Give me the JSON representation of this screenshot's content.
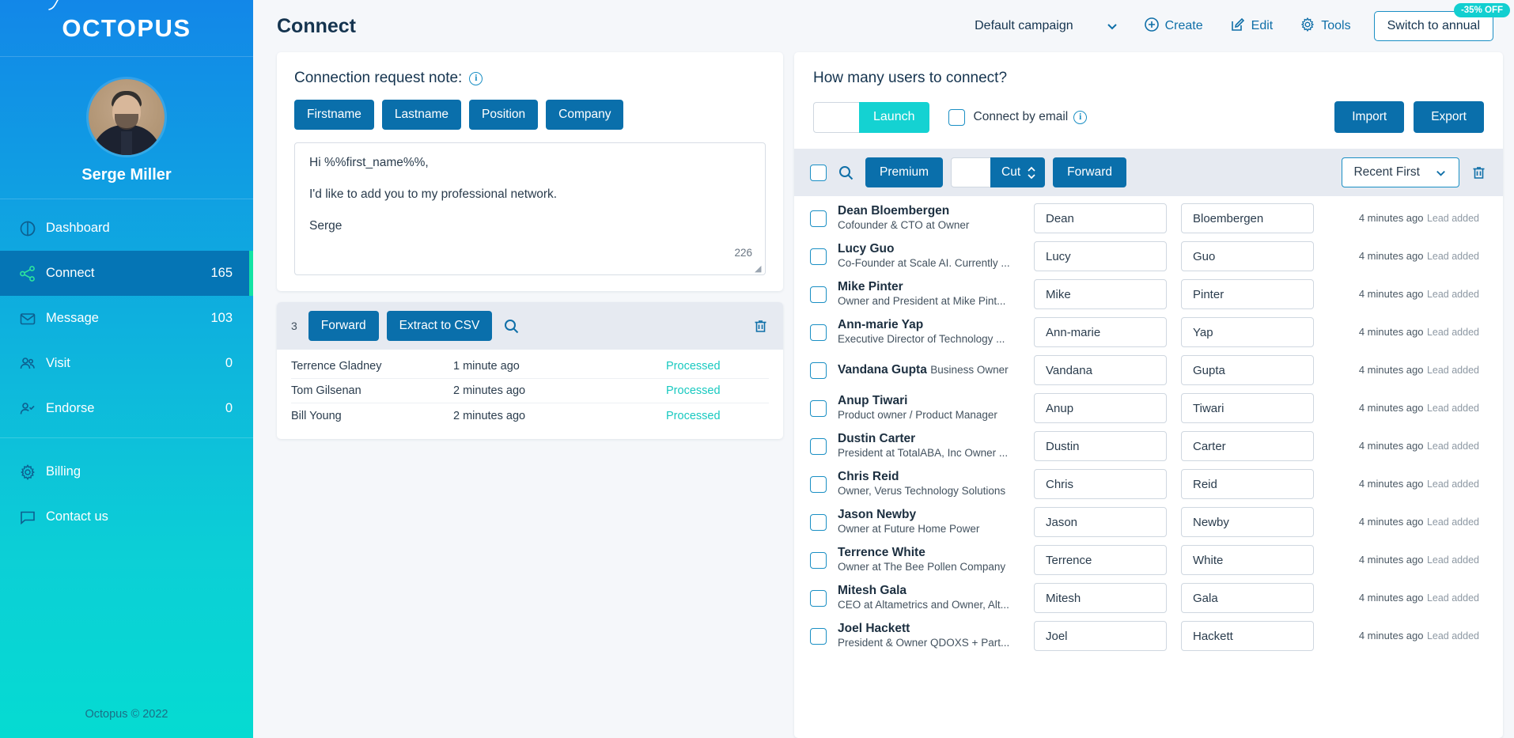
{
  "brand": {
    "logo_text": "OCTOPUS",
    "accent_blue": "#0a6fab",
    "accent_teal": "#14d2d2",
    "active_green": "#12e3a4"
  },
  "sidebar": {
    "profile_name": "Serge Miller",
    "items": [
      {
        "label": "Dashboard",
        "count": "",
        "icon": "pie-chart-icon",
        "active": false
      },
      {
        "label": "Connect",
        "count": "165",
        "icon": "share-nodes-icon",
        "active": true
      },
      {
        "label": "Message",
        "count": "103",
        "icon": "envelope-icon",
        "active": false
      },
      {
        "label": "Visit",
        "count": "0",
        "icon": "users-icon",
        "active": false
      },
      {
        "label": "Endorse",
        "count": "0",
        "icon": "user-check-icon",
        "active": false
      }
    ],
    "bottom_items": [
      {
        "label": "Billing",
        "icon": "gear-icon"
      },
      {
        "label": "Contact us",
        "icon": "chat-bubble-icon"
      }
    ],
    "footer": "Octopus © 2022"
  },
  "topbar": {
    "page_title": "Connect",
    "campaign": "Default campaign",
    "create_label": "Create",
    "edit_label": "Edit",
    "tools_label": "Tools",
    "switch_label": "Switch to annual",
    "discount_badge": "-35% OFF"
  },
  "note": {
    "heading": "Connection request note:",
    "info_glyph": "i",
    "tags": [
      "Firstname",
      "Lastname",
      "Position",
      "Company"
    ],
    "lines": [
      "Hi %%first_name%%,",
      "I'd like to add you to my professional network.",
      "Serge"
    ],
    "char_count": "226"
  },
  "queue": {
    "count": "3",
    "forward_label": "Forward",
    "extract_label": "Extract to CSV",
    "rows": [
      {
        "name": "Terrence Gladney",
        "time": "1 minute ago",
        "status": "Processed"
      },
      {
        "name": "Tom Gilsenan",
        "time": "2 minutes ago",
        "status": "Processed"
      },
      {
        "name": "Bill Young",
        "time": "2 minutes ago",
        "status": "Processed"
      }
    ]
  },
  "right_panel": {
    "title": "How many users to connect?",
    "amount_value": "",
    "launch_label": "Launch",
    "connect_by_email_label": "Connect by email",
    "import_label": "Import",
    "export_label": "Export",
    "filter": {
      "premium_label": "Premium",
      "cut_value": "",
      "cut_label": "Cut",
      "forward_label": "Forward",
      "sort_value": "Recent First"
    },
    "contacts": [
      {
        "name": "Dean Bloembergen",
        "role": "Cofounder & CTO at Owner",
        "first": "Dean",
        "last": "Bloembergen",
        "time": "4 minutes ago",
        "event": "Lead added"
      },
      {
        "name": "Lucy Guo",
        "role": "Co-Founder at Scale AI. Currently ...",
        "first": "Lucy",
        "last": "Guo",
        "time": "4 minutes ago",
        "event": "Lead added"
      },
      {
        "name": "Mike Pinter",
        "role": "Owner and President at Mike Pint...",
        "first": "Mike",
        "last": "Pinter",
        "time": "4 minutes ago",
        "event": "Lead added"
      },
      {
        "name": "Ann-marie Yap",
        "role": "Executive Director of Technology ...",
        "first": "Ann-marie",
        "last": "Yap",
        "time": "4 minutes ago",
        "event": "Lead added"
      },
      {
        "name": "Vandana Gupta",
        "role": "Business Owner",
        "first": "Vandana",
        "last": "Gupta",
        "time": "4 minutes ago",
        "event": "Lead added"
      },
      {
        "name": "Anup Tiwari",
        "role": "Product owner / Product Manager",
        "first": "Anup",
        "last": "Tiwari",
        "time": "4 minutes ago",
        "event": "Lead added"
      },
      {
        "name": "Dustin Carter",
        "role": "President at TotalABA, Inc Owner ...",
        "first": "Dustin",
        "last": "Carter",
        "time": "4 minutes ago",
        "event": "Lead added"
      },
      {
        "name": "Chris Reid",
        "role": "Owner, Verus Technology Solutions",
        "first": "Chris",
        "last": "Reid",
        "time": "4 minutes ago",
        "event": "Lead added"
      },
      {
        "name": "Jason Newby",
        "role": "Owner at Future Home Power",
        "first": "Jason",
        "last": "Newby",
        "time": "4 minutes ago",
        "event": "Lead added"
      },
      {
        "name": "Terrence White",
        "role": "Owner at The Bee Pollen Company",
        "first": "Terrence",
        "last": "White",
        "time": "4 minutes ago",
        "event": "Lead added"
      },
      {
        "name": "Mitesh Gala",
        "role": "CEO at Altametrics and Owner, Alt...",
        "first": "Mitesh",
        "last": "Gala",
        "time": "4 minutes ago",
        "event": "Lead added"
      },
      {
        "name": "Joel Hackett",
        "role": "President & Owner QDOXS + Part...",
        "first": "Joel",
        "last": "Hackett",
        "time": "4 minutes ago",
        "event": "Lead added"
      }
    ]
  }
}
